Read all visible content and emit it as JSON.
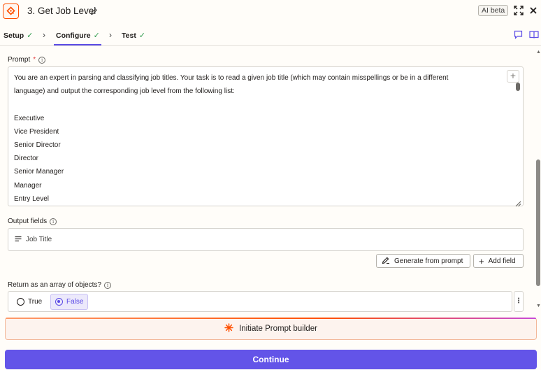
{
  "header": {
    "title": "3. Get Job Level",
    "badge": "AI beta"
  },
  "tabs": [
    {
      "label": "Setup",
      "complete": true
    },
    {
      "label": "Configure",
      "complete": true,
      "active": true
    },
    {
      "label": "Test",
      "complete": true
    }
  ],
  "prompt": {
    "label": "Prompt",
    "required_mark": "*",
    "lines": [
      "You are an expert in parsing and classifying job titles. Your task is to read a given job title (which may contain misspellings or be in a different",
      "language) and output the corresponding job level from the following list:",
      "",
      "Executive",
      "Vice President",
      "Senior Director",
      "Director",
      "Senior Manager",
      "Manager",
      "Entry Level"
    ]
  },
  "output_fields": {
    "label": "Output fields",
    "fields": [
      "Job Title"
    ],
    "generate_label": "Generate from prompt",
    "add_label": "Add field"
  },
  "return_array": {
    "label": "Return as an array of objects?",
    "options": [
      "True",
      "False"
    ],
    "selected": "False"
  },
  "buttons": {
    "builder": "Initiate Prompt builder",
    "continue": "Continue"
  },
  "colors": {
    "accent": "#6354e8",
    "brand": "#ff4f00",
    "success": "#2d9a4a"
  }
}
